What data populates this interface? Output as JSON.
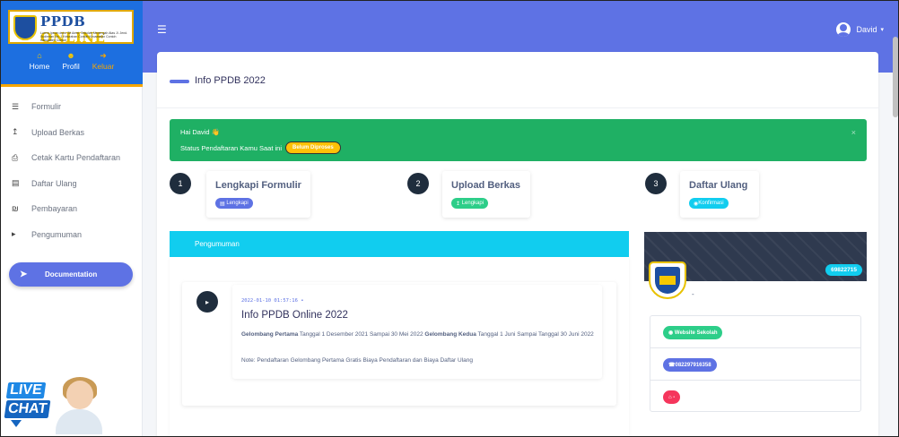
{
  "colors": {
    "primary": "#5e72e4",
    "sidebar_header": "#1d6fe0",
    "accent": "#f7a600",
    "alert_green": "#1fb064",
    "info_cyan": "#11cdef",
    "warning": "#ffc107",
    "success": "#2dce89",
    "danger": "#f5365c",
    "dark": "#1f2d3d"
  },
  "sidebar": {
    "logo": {
      "title_main": "PPDB",
      "title_accent": "ONLINE",
      "subtitle": "Lorem Ipsum dolor Sit Amet, Sekolah Menengah Atas Jl. Jend. Sudirman No. 1 Kelurahan Contoh Kecamatan Contoh Kabupaten Contoh"
    },
    "top_links": [
      {
        "label": "Home",
        "icon": "home-icon"
      },
      {
        "label": "Profil",
        "icon": "user-icon"
      },
      {
        "label": "Keluar",
        "icon": "logout-icon"
      }
    ],
    "nav_items": [
      {
        "label": "Formulir",
        "icon": "list-icon"
      },
      {
        "label": "Upload Berkas",
        "icon": "upload-icon"
      },
      {
        "label": "Cetak Kartu Pendaftaran",
        "icon": "print-icon"
      },
      {
        "label": "Daftar Ulang",
        "icon": "id-card-icon"
      },
      {
        "label": "Pembayaran",
        "icon": "money-icon"
      },
      {
        "label": "Pengumuman",
        "icon": "megaphone-icon"
      }
    ],
    "doc_button": {
      "label": "Documentation",
      "icon": "rocket-icon"
    },
    "live_chat": {
      "line1": "LIVE",
      "line2": "CHAT"
    }
  },
  "header": {
    "menu_icon": "hamburger-icon",
    "user_name": "David"
  },
  "page": {
    "title": "Info PPDB 2022"
  },
  "alert": {
    "greeting": "Hai David 👋",
    "status_label": "Status Pendaftaran Kamu Saat ini",
    "status_badge": "Belum Diproses",
    "close": "×"
  },
  "steps": [
    {
      "number": "1",
      "title": "Lengkapi Formulir",
      "badge": "Lengkapi",
      "badge_icon": "form-icon",
      "color": "#5e72e4"
    },
    {
      "number": "2",
      "title": "Upload Berkas",
      "badge": "Lengkapi",
      "badge_icon": "upload-icon",
      "color": "#2dce89"
    },
    {
      "number": "3",
      "title": "Daftar Ulang",
      "badge": "Konfirmasi",
      "badge_icon": "eye-icon",
      "color": "#11cdef"
    }
  ],
  "announcement": {
    "header": "Pengumuman",
    "date": "2022-01-10 01:57:16",
    "title": "Info PPDB Online 2022",
    "gel1_label": "Gelombang Pertama",
    "gel1_text": "Tanggal 1 Desember 2021 Sampai 30 Mei 2022",
    "gel2_label": "Gelombang Kedua",
    "gel2_text": "Tanggal 1 Juni Sampai Tanggal 30 Juni 2022",
    "note": "Note: Pendaftaran Gelombang Pertama Gratis Biaya Pendaftaran dan Biaya Daftar Ulang"
  },
  "school": {
    "npsn": "69822715",
    "logo_text": "SMA",
    "name": "-",
    "links": [
      {
        "label": "Website Sekolah",
        "icon": "globe-icon",
        "color": "#2dce89"
      },
      {
        "label": "082297916358",
        "icon": "whatsapp-icon",
        "color": "#5e72e4"
      },
      {
        "label": "-",
        "icon": "home-icon",
        "color": "#f5365c"
      }
    ]
  }
}
